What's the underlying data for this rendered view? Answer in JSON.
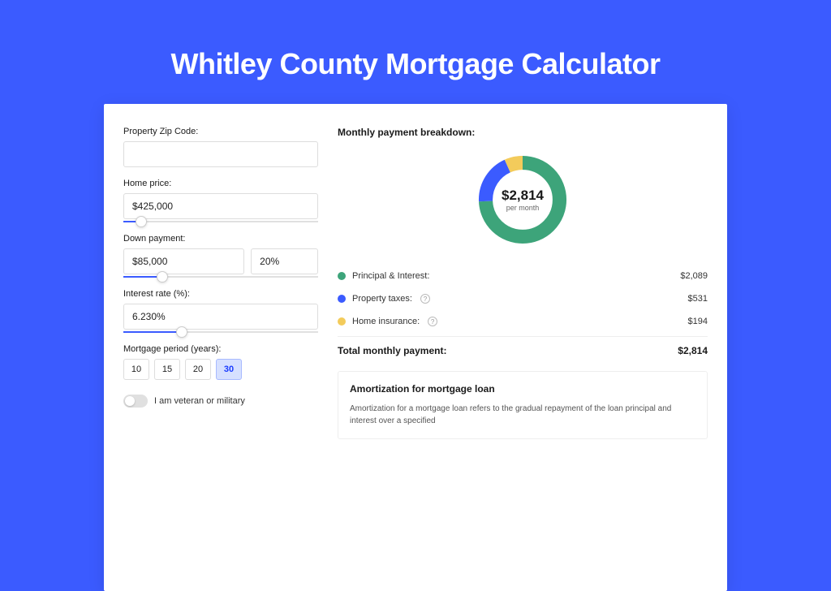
{
  "title": "Whitley County Mortgage Calculator",
  "colors": {
    "accent": "#3B5BFF",
    "principal": "#3DA47A",
    "taxes": "#3B5BFF",
    "insurance": "#F3CB5B"
  },
  "form": {
    "zip": {
      "label": "Property Zip Code:",
      "value": ""
    },
    "home_price": {
      "label": "Home price:",
      "value": "$425,000",
      "slider_pct": 9
    },
    "down_payment": {
      "label": "Down payment:",
      "amount": "$85,000",
      "percent": "20%",
      "slider_pct": 20
    },
    "interest_rate": {
      "label": "Interest rate (%):",
      "value": "6.230%",
      "slider_pct": 30
    },
    "period": {
      "label": "Mortgage period (years):",
      "options": [
        "10",
        "15",
        "20",
        "30"
      ],
      "active": "30"
    },
    "veteran": {
      "label": "I am veteran or military",
      "on": false
    }
  },
  "breakdown": {
    "title": "Monthly payment breakdown:",
    "center_amount": "$2,814",
    "center_sub": "per month",
    "items": [
      {
        "id": "principal",
        "label": "Principal & Interest:",
        "value": "$2,089",
        "color": "#3DA47A",
        "info": false
      },
      {
        "id": "taxes",
        "label": "Property taxes:",
        "value": "$531",
        "color": "#3B5BFF",
        "info": true
      },
      {
        "id": "insurance",
        "label": "Home insurance:",
        "value": "$194",
        "color": "#F3CB5B",
        "info": true
      }
    ],
    "total": {
      "label": "Total monthly payment:",
      "value": "$2,814"
    }
  },
  "amortization": {
    "title": "Amortization for mortgage loan",
    "text": "Amortization for a mortgage loan refers to the gradual repayment of the loan principal and interest over a specified"
  },
  "chart_data": {
    "type": "pie",
    "title": "Monthly payment breakdown",
    "categories": [
      "Principal & Interest",
      "Property taxes",
      "Home insurance"
    ],
    "values": [
      2089,
      531,
      194
    ],
    "colors": [
      "#3DA47A",
      "#3B5BFF",
      "#F3CB5B"
    ],
    "total": 2814,
    "unit": "USD/month"
  }
}
